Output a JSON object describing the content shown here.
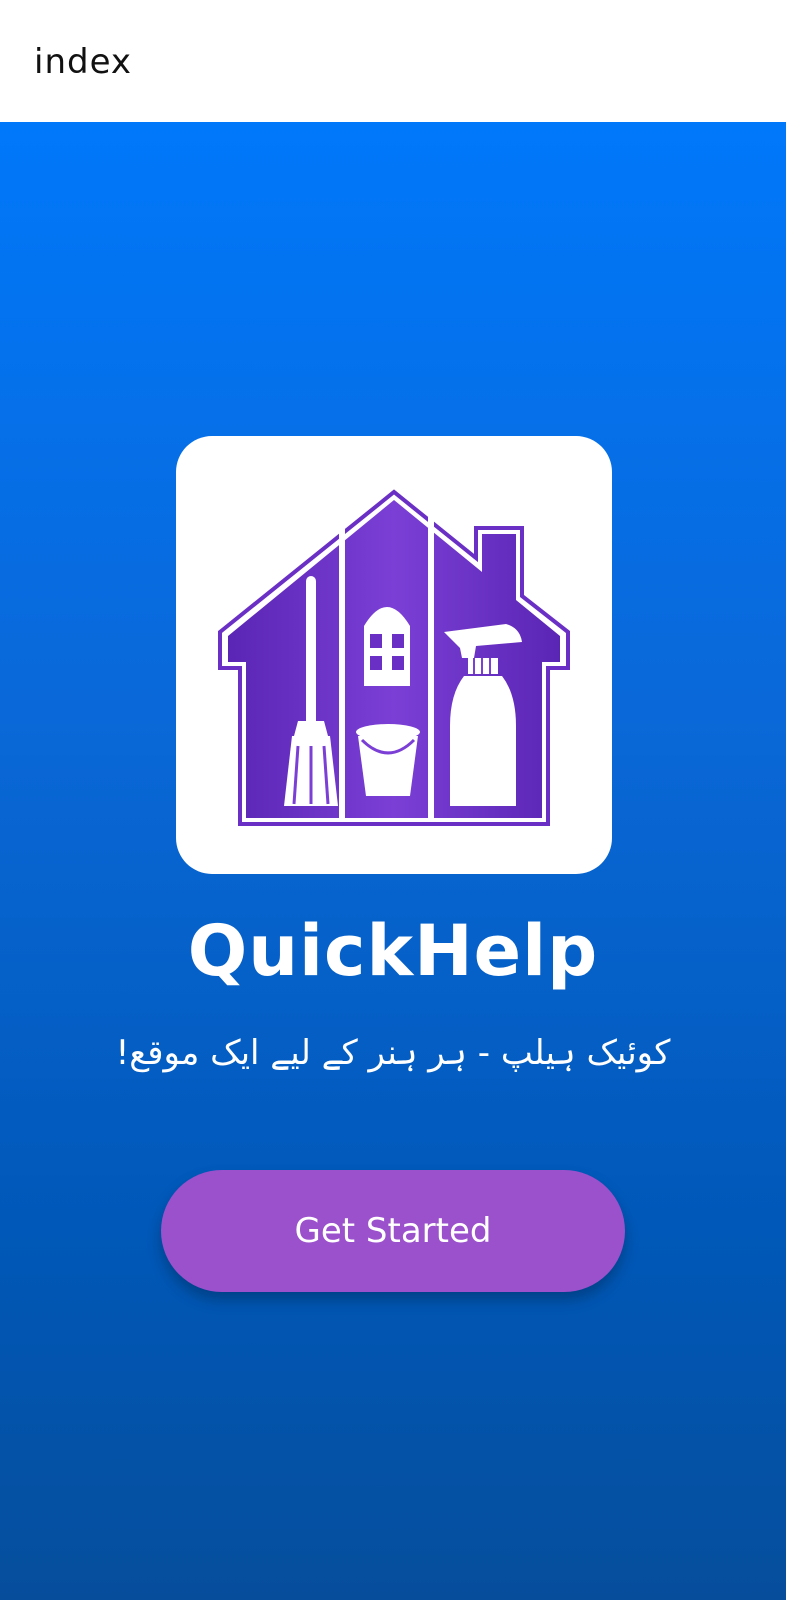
{
  "header": {
    "title": "index"
  },
  "app": {
    "name": "QuickHelp",
    "tagline": "کوئیک ہیلپ - ہر ہنر کے لیے ایک موقع!"
  },
  "cta": {
    "label": "Get Started"
  },
  "logo": {
    "icon": "house-cleaning-icon"
  },
  "colors": {
    "background_top": "#0078fa",
    "background_bottom": "#064e9c",
    "button": "#9b50cc",
    "logo_purple": "#6a2fc4"
  }
}
